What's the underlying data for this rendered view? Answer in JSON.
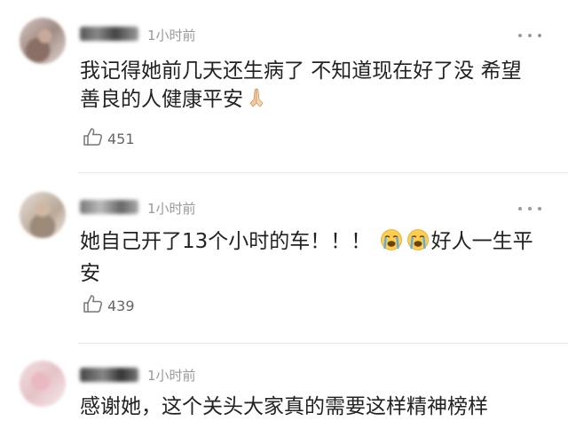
{
  "comments": [
    {
      "time": "1小时前",
      "text": "我记得她前几天还生病了 不知道现在好了没 希望善良的人健康平安",
      "emoji": [
        "folded-hands"
      ],
      "likes": "451"
    },
    {
      "time": "1小时前",
      "text_before": "她自己开了13个小时的车！！！",
      "emoji": [
        "loudly-crying-face",
        "loudly-crying-face"
      ],
      "text_after": "好人一生平安",
      "likes": "439"
    },
    {
      "time": "1小时前",
      "text": "感谢她，这个关头大家真的需要这样精神榜样"
    }
  ],
  "colors": {
    "time": "#999999",
    "text": "#222222",
    "like": "#666666",
    "divider": "#e8e8e8"
  }
}
